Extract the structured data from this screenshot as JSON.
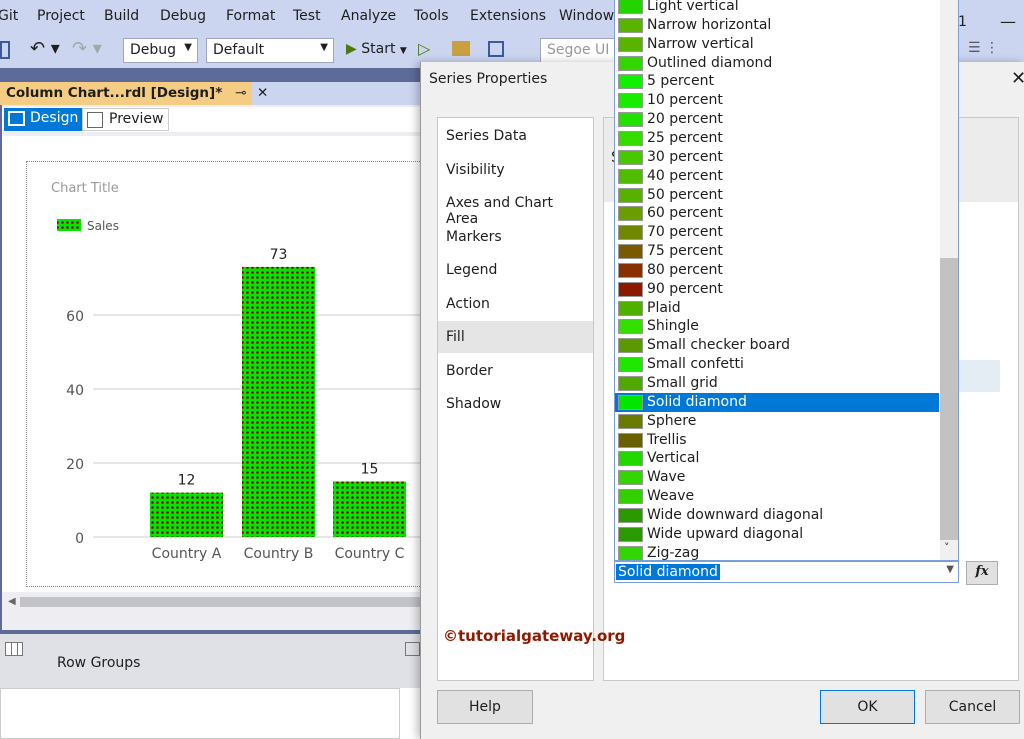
{
  "menu": [
    "Git",
    "Project",
    "Build",
    "Debug",
    "Format",
    "Test",
    "Analyze",
    "Tools",
    "Extensions",
    "Window"
  ],
  "toolbar": {
    "config": "Debug",
    "platform": "Default",
    "start": "Start",
    "font": "Segoe UI",
    "badge": "1"
  },
  "document": {
    "tab_title": "Column Chart...rdl [Design]*",
    "design_tab": "Design",
    "preview_tab": "Preview",
    "row_groups": "Row Groups"
  },
  "chart_data": {
    "type": "bar",
    "title": "Chart Title",
    "legend": [
      "Sales"
    ],
    "categories": [
      "Country A",
      "Country B",
      "Country C"
    ],
    "values": [
      12,
      73,
      15
    ],
    "yticks": [
      "0",
      "20",
      "40",
      "60"
    ],
    "ylim": [
      0,
      80
    ],
    "data_labels": [
      "12",
      "73",
      "15"
    ],
    "colors": {
      "fill": "#00e600",
      "pattern": "#8b0000"
    }
  },
  "dialog": {
    "title": "Series Properties",
    "nav": [
      "Series Data",
      "Visibility",
      "Axes and Chart Area",
      "Markers",
      "Legend",
      "Action",
      "Fill",
      "Border",
      "Shadow"
    ],
    "selected_nav": "Fill",
    "panel_letter": "S",
    "help": "Help",
    "ok": "OK",
    "cancel": "Cancel",
    "fx": "fx",
    "watermark": "©tutorialgateway.org"
  },
  "pattern_list": {
    "selected": "Solid diamond",
    "items": [
      {
        "label": "Light vertical",
        "color": "#22d400"
      },
      {
        "label": "Narrow horizontal",
        "color": "#5ab300"
      },
      {
        "label": "Narrow vertical",
        "color": "#5ab300"
      },
      {
        "label": "Outlined diamond",
        "color": "#33d600"
      },
      {
        "label": "5 percent",
        "color": "#11f000"
      },
      {
        "label": "10 percent",
        "color": "#18ec00"
      },
      {
        "label": "20 percent",
        "color": "#22e000"
      },
      {
        "label": "25 percent",
        "color": "#33dd00"
      },
      {
        "label": "30 percent",
        "color": "#48c800"
      },
      {
        "label": "40 percent",
        "color": "#50bb00"
      },
      {
        "label": "50 percent",
        "color": "#58b000"
      },
      {
        "label": "60 percent",
        "color": "#6a9d00"
      },
      {
        "label": "70 percent",
        "color": "#708800"
      },
      {
        "label": "75 percent",
        "color": "#7a5a00"
      },
      {
        "label": "80 percent",
        "color": "#8a3000"
      },
      {
        "label": "90 percent",
        "color": "#8b1a00"
      },
      {
        "label": "Plaid",
        "color": "#4fb000"
      },
      {
        "label": "Shingle",
        "color": "#33e000"
      },
      {
        "label": "Small checker board",
        "color": "#5a9a00"
      },
      {
        "label": "Small confetti",
        "color": "#1ee800"
      },
      {
        "label": "Small grid",
        "color": "#50a800"
      },
      {
        "label": "Solid diamond",
        "color": "#00e600"
      },
      {
        "label": "Sphere",
        "color": "#6a7a00"
      },
      {
        "label": "Trellis",
        "color": "#6a6000"
      },
      {
        "label": "Vertical",
        "color": "#22d800"
      },
      {
        "label": "Wave",
        "color": "#33d600"
      },
      {
        "label": "Weave",
        "color": "#33d000"
      },
      {
        "label": "Wide downward diagonal",
        "color": "#2a9a00"
      },
      {
        "label": "Wide upward diagonal",
        "color": "#2a9a00"
      },
      {
        "label": "Zig-zag",
        "color": "#33d600"
      }
    ]
  }
}
